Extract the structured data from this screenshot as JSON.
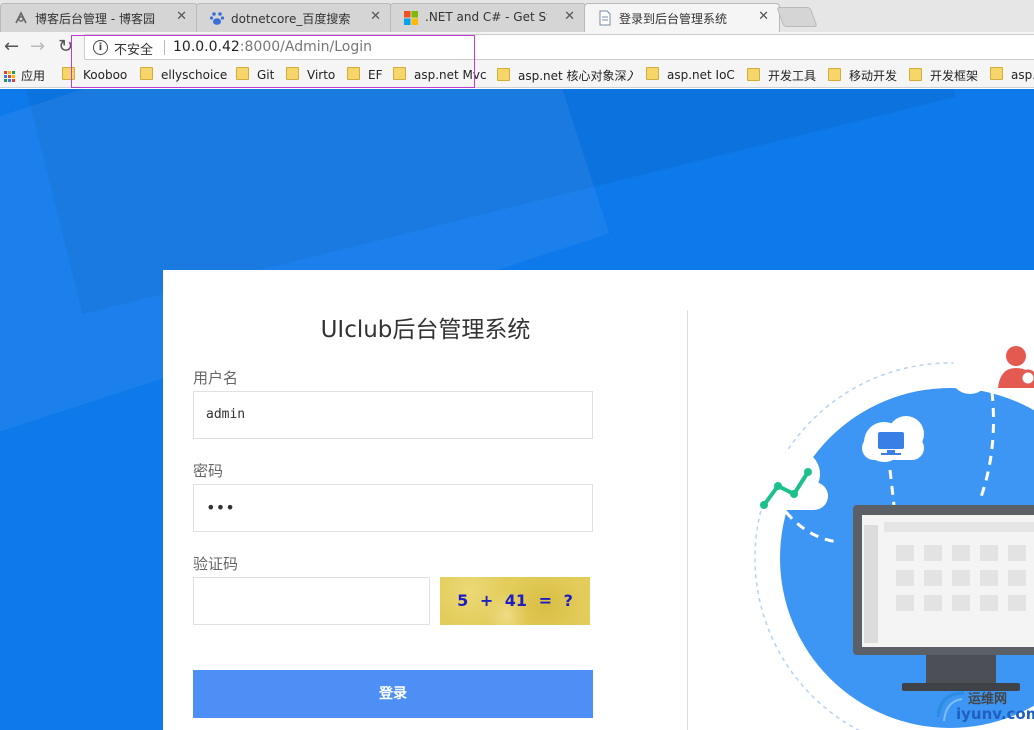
{
  "tabs": [
    {
      "title": "博客后台管理 - 博客园",
      "icon": "cnblogs-icon"
    },
    {
      "title": "dotnetcore_百度搜索",
      "icon": "baidu-paw-icon"
    },
    {
      "title": ".NET and C# - Get Start",
      "icon": "microsoft-logo-icon"
    },
    {
      "title": "登录到后台管理系统",
      "icon": "document-icon"
    }
  ],
  "toolbar": {
    "security_label": "不安全",
    "url_host": "10.0.0.42",
    "url_path": ":8000/Admin/Login"
  },
  "bookmarks": {
    "apps_label": "应用",
    "items": [
      "Kooboo",
      "ellyschoice",
      "Git",
      "Virto",
      "EF",
      "asp.net Mvc",
      "asp.net 核心对象深入",
      "asp.net  IoC",
      "开发工具",
      "移动开发",
      "开发框架",
      "asp.n"
    ]
  },
  "login": {
    "title": "UIclub后台管理系统",
    "username_label": "用户名",
    "username_value": "admin",
    "password_label": "密码",
    "password_value": "•••",
    "captcha_label": "验证码",
    "captcha_value": "",
    "captcha_text": "5 + 41 = ?",
    "submit_label": "登录"
  },
  "watermark": {
    "line1": "运维网",
    "line2": "iyunv.com"
  },
  "colors": {
    "page_background": "#0d79ea",
    "button": "#4d8ff5",
    "captcha_text": "#1d1fc2",
    "address_highlight": "#c23ad5"
  }
}
